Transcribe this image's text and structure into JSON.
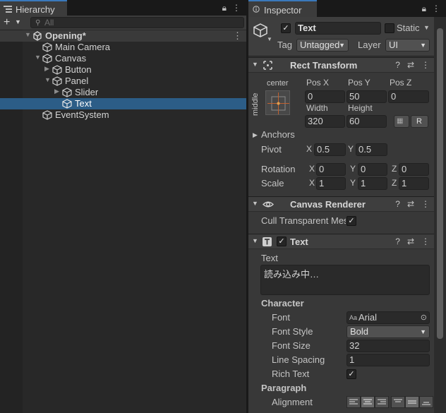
{
  "hierarchy": {
    "tab_label": "Hierarchy",
    "search_placeholder": "All",
    "items": [
      {
        "label": "Opening*",
        "kind": "scene"
      },
      {
        "label": "Main Camera"
      },
      {
        "label": "Canvas"
      },
      {
        "label": "Button"
      },
      {
        "label": "Panel"
      },
      {
        "label": "Slider"
      },
      {
        "label": "Text",
        "selected": true
      },
      {
        "label": "EventSystem"
      }
    ]
  },
  "inspector": {
    "tab_label": "Inspector",
    "gameobject": {
      "name": "Text",
      "static_label": "Static",
      "tag_label": "Tag",
      "tag_value": "Untagged",
      "layer_label": "Layer",
      "layer_value": "UI"
    },
    "rect_transform": {
      "title": "Rect Transform",
      "anchor_h": "center",
      "anchor_v": "middle",
      "pos_x_label": "Pos X",
      "pos_x": "0",
      "pos_y_label": "Pos Y",
      "pos_y": "50",
      "pos_z_label": "Pos Z",
      "pos_z": "0",
      "width_label": "Width",
      "width": "320",
      "height_label": "Height",
      "height": "60",
      "r_button": "R",
      "anchors_label": "Anchors",
      "pivot_label": "Pivot",
      "pivot_x": "0.5",
      "pivot_y": "0.5",
      "rotation_label": "Rotation",
      "rot_x": "0",
      "rot_y": "0",
      "rot_z": "0",
      "scale_label": "Scale",
      "scale_x": "1",
      "scale_y": "1",
      "scale_z": "1",
      "x": "X",
      "y": "Y",
      "z": "Z"
    },
    "canvas_renderer": {
      "title": "Canvas Renderer",
      "cull_label": "Cull Transparent Mesh"
    },
    "text_component": {
      "title": "Text",
      "text_label": "Text",
      "text_value": "読み込み中…",
      "character_label": "Character",
      "font_label": "Font",
      "font_value": "Arial",
      "font_style_label": "Font Style",
      "font_style_value": "Bold",
      "font_size_label": "Font Size",
      "font_size_value": "32",
      "line_spacing_label": "Line Spacing",
      "line_spacing_value": "1",
      "rich_text_label": "Rich Text",
      "paragraph_label": "Paragraph",
      "alignment_label": "Alignment"
    }
  },
  "icons": {
    "lock": "lock-icon",
    "menu": "kebab-menu-icon",
    "help": "help-icon",
    "presets": "presets-icon",
    "eye": "eye-icon",
    "cube": "gameobject-cube-icon",
    "move": "rect-tool-icon",
    "text": "text-component-icon",
    "unity": "unity-scene-icon"
  },
  "colors": {
    "selection": "#2c5d87",
    "tab_accent": "#3a79bb",
    "panel_bg": "#383838",
    "hierarchy_bg": "#282828"
  }
}
